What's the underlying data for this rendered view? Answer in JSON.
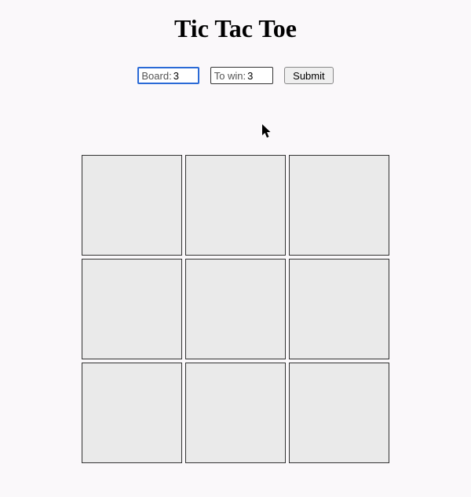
{
  "title": "Tic Tac Toe",
  "controls": {
    "board_label": "Board: ",
    "board_value": "3",
    "towin_label": "To win: ",
    "towin_value": "3",
    "submit_label": "Submit"
  },
  "board": {
    "size": 3,
    "cells": [
      "",
      "",
      "",
      "",
      "",
      "",
      "",
      "",
      ""
    ]
  }
}
